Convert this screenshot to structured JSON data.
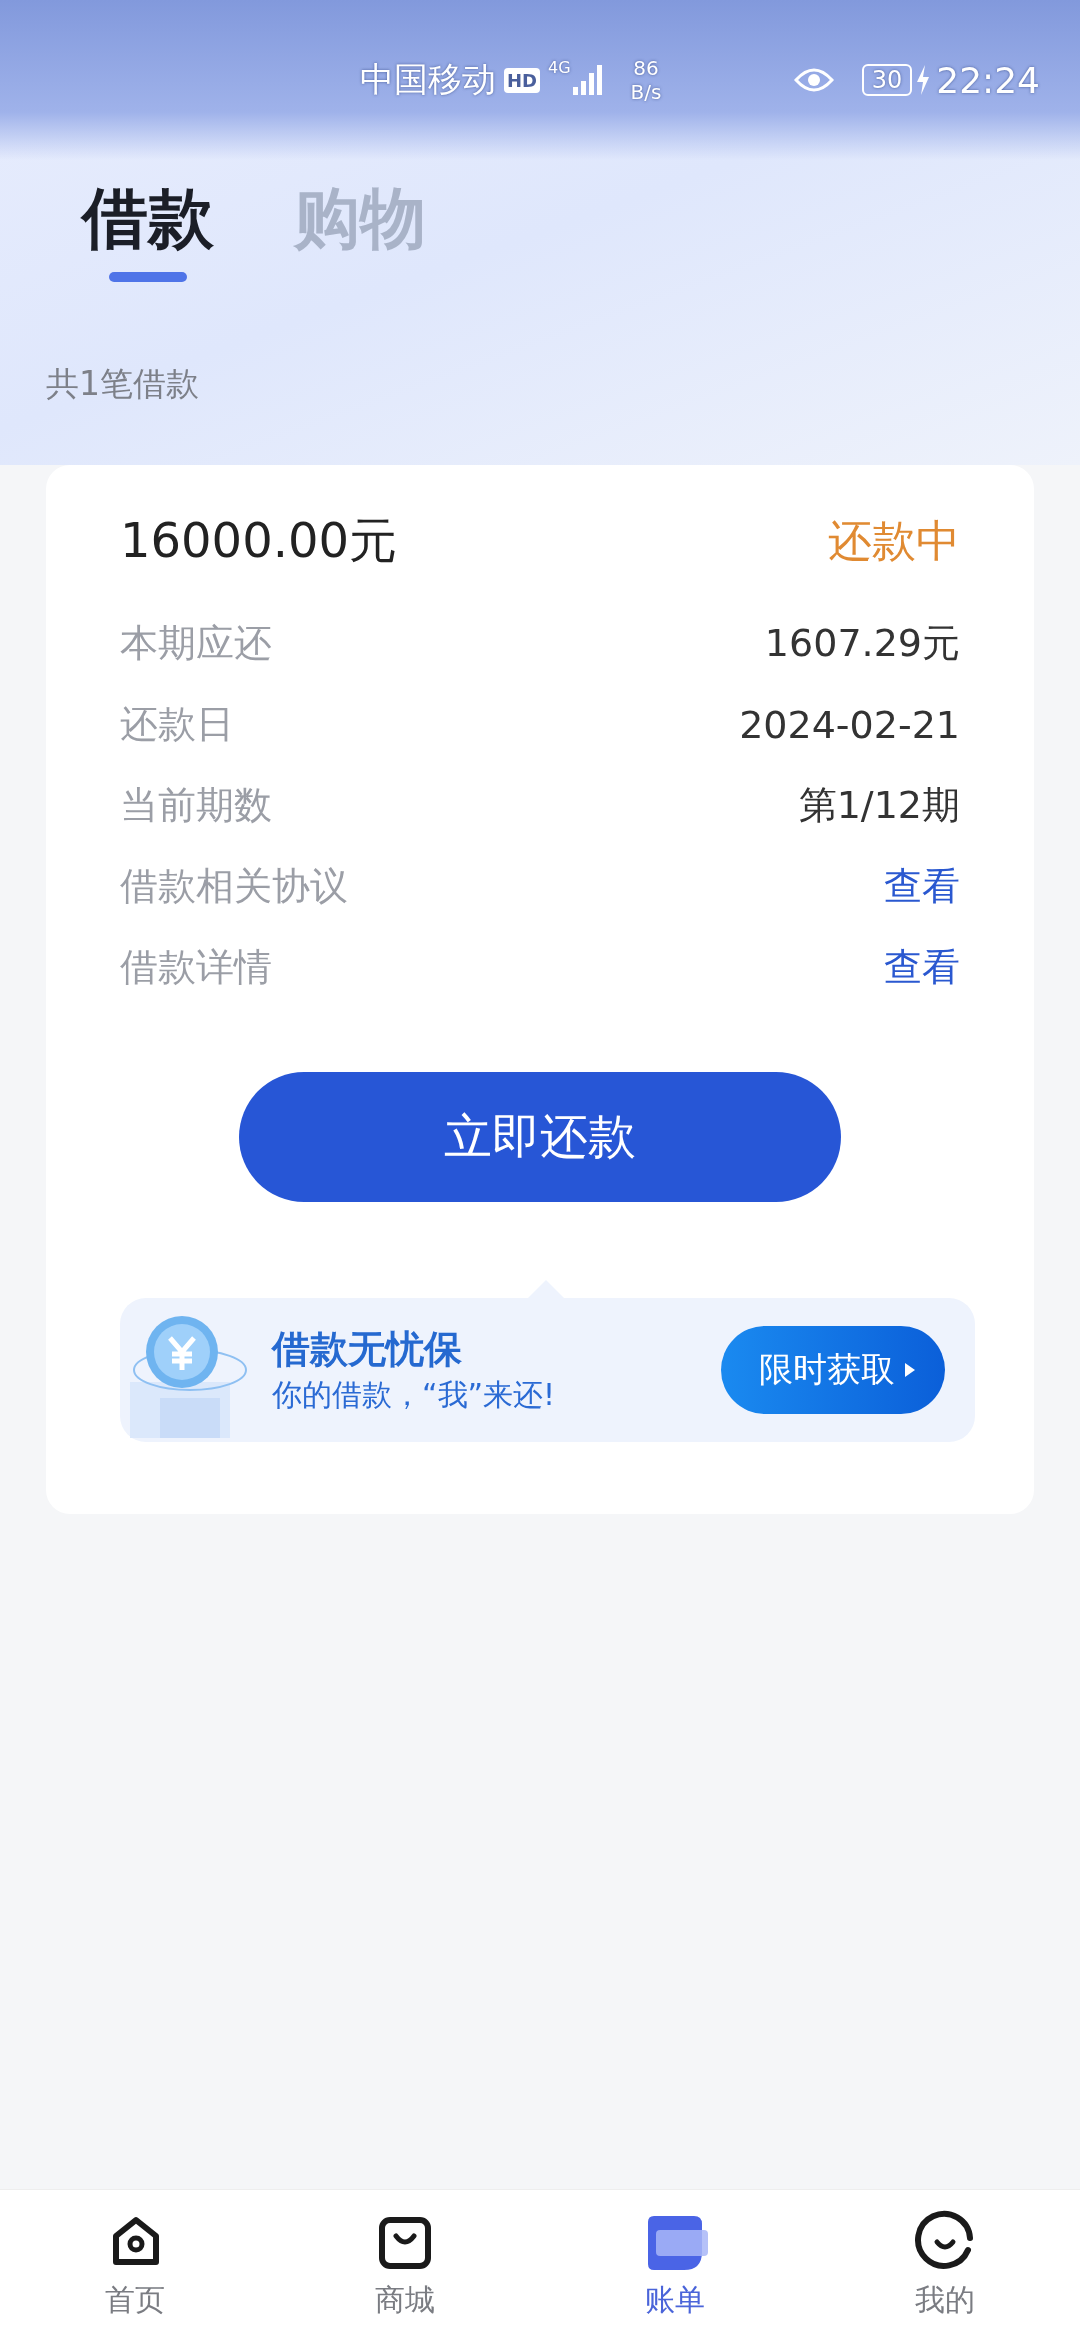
{
  "status_bar": {
    "carrier": "中国移动",
    "hd": "HD",
    "network": "4G",
    "speed_value": "86",
    "speed_unit": "B/s",
    "battery": "30",
    "time": "22:24"
  },
  "tabs": [
    {
      "label": "借款",
      "selected": true
    },
    {
      "label": "购物",
      "selected": false
    }
  ],
  "summary": "共1笔借款",
  "loan": {
    "amount": "16000.00元",
    "status": "还款中",
    "rows": [
      {
        "label": "本期应还",
        "value": "1607.29元",
        "kind": "value"
      },
      {
        "label": "还款日",
        "value": "2024-02-21",
        "kind": "value"
      },
      {
        "label": "当前期数",
        "value": "第1/12期",
        "kind": "value"
      },
      {
        "label": "借款相关协议",
        "value": "查看",
        "kind": "link"
      },
      {
        "label": "借款详情",
        "value": "查看",
        "kind": "link"
      }
    ],
    "repay_button": "立即还款",
    "promo": {
      "title": "借款无忧保",
      "subtitle": "你的借款，“我”来还!",
      "button": "限时获取"
    }
  },
  "bottom_nav": [
    {
      "label": "首页",
      "selected": false
    },
    {
      "label": "商城",
      "selected": false
    },
    {
      "label": "账单",
      "selected": true
    },
    {
      "label": "我的",
      "selected": false
    }
  ]
}
